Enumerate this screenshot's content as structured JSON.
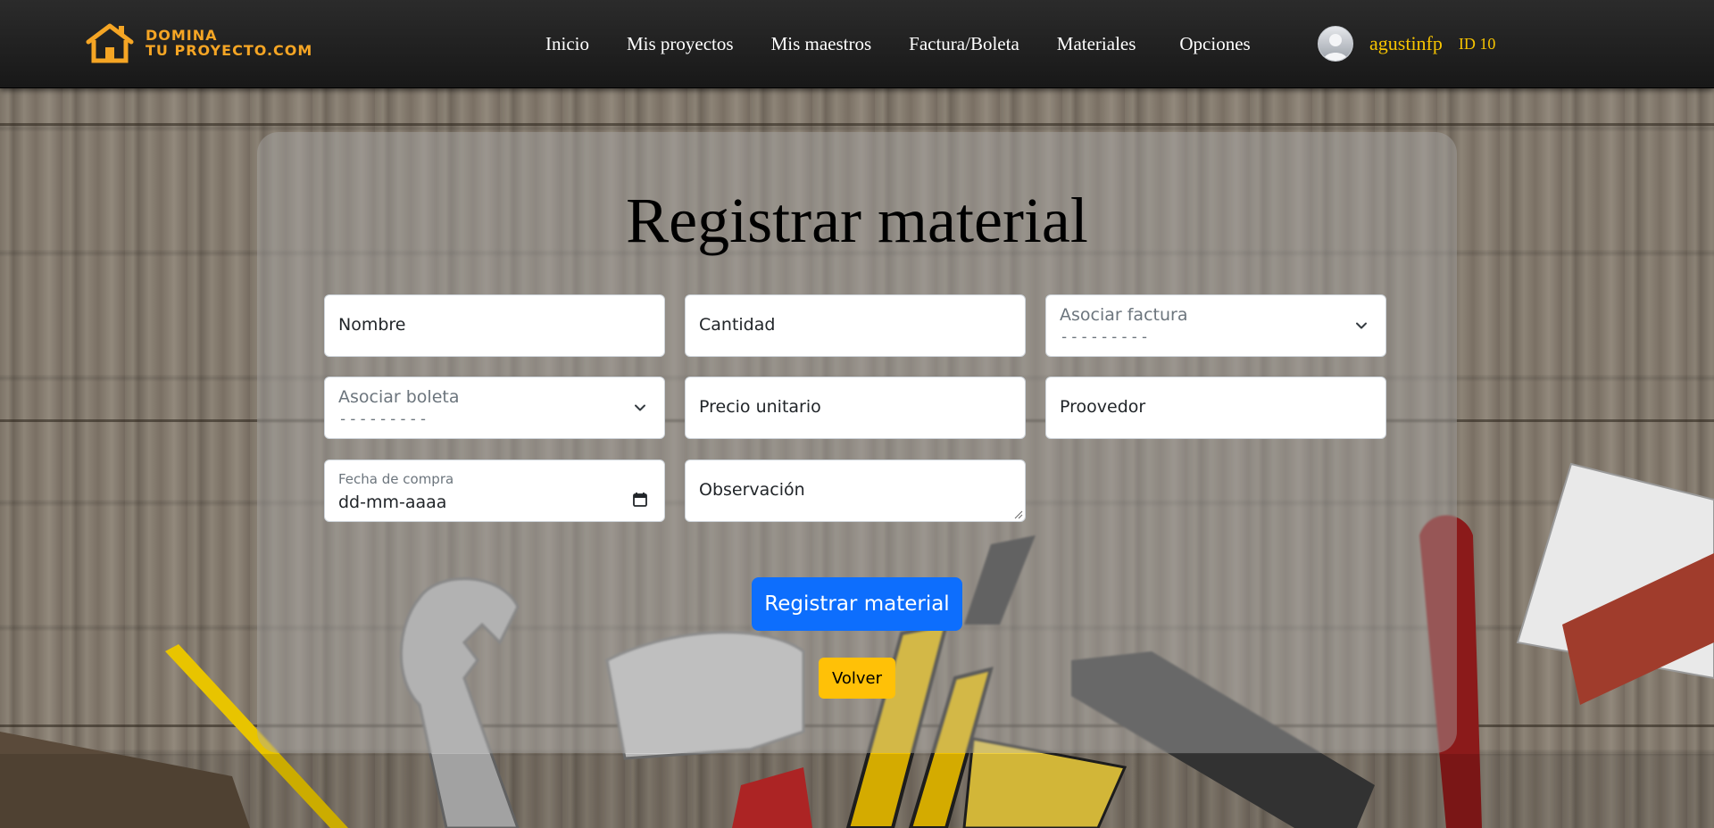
{
  "brand": {
    "line1": "DOMINA",
    "line2": "TU PROYECTO.COM",
    "icon": "house-icon",
    "color": "#f5a524"
  },
  "nav": {
    "items": [
      {
        "label": "Inicio"
      },
      {
        "label": "Mis proyectos"
      },
      {
        "label": "Mis maestros"
      },
      {
        "label": "Factura/Boleta"
      },
      {
        "label": "Materiales"
      },
      {
        "label": "Opciones"
      }
    ]
  },
  "user": {
    "avatar_icon": "user-avatar-icon",
    "name": "agustinfp",
    "id_label": "ID 10",
    "color": "#f7c400"
  },
  "form": {
    "title": "Registrar material",
    "fields": {
      "nombre": "Nombre",
      "cantidad": "Cantidad",
      "asociar_factura_label": "Asociar factura",
      "asociar_factura_value": "---------",
      "asociar_boleta_label": "Asociar boleta",
      "asociar_boleta_value": "---------",
      "precio_unitario": "Precio unitario",
      "proovedor": "Proovedor",
      "fecha_label": "Fecha de compra",
      "fecha_value": "dd-mm-aaaa",
      "observacion": "Observación"
    },
    "submit_label": "Registrar material",
    "back_label": "Volver",
    "colors": {
      "primary": "#0d6efd",
      "warning": "#ffc107"
    }
  }
}
